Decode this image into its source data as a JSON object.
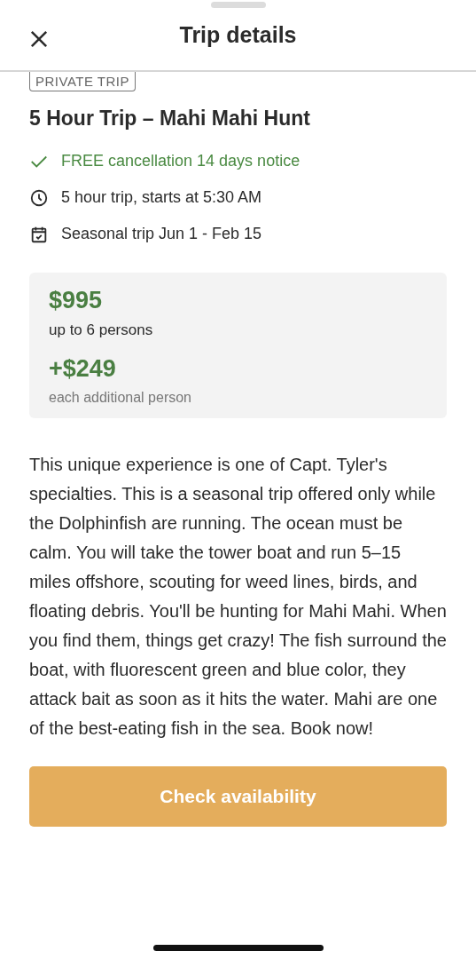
{
  "header": {
    "title": "Trip details"
  },
  "tag": "PRIVATE TRIP",
  "trip_title": "5 Hour Trip – Mahi Mahi Hunt",
  "features": [
    {
      "kind": "check",
      "text": "FREE cancellation 14 days notice"
    },
    {
      "kind": "clock",
      "text": "5 hour trip, starts at 5:30 AM"
    },
    {
      "kind": "calendar",
      "text": "Seasonal trip Jun 1 - Feb 15"
    }
  ],
  "pricing": {
    "price": "$995",
    "price_note": "up to 6 persons",
    "extra_price": "+$249",
    "extra_note": "each additional person"
  },
  "description": "This unique experience is one of Capt. Tyler's specialties. This is a seasonal trip offered only while the Dolphinfish are running. The ocean must be calm. You will take the tower boat and run 5–15 miles offshore, scouting for weed lines, birds, and floating debris. You'll be hunting for Mahi Mahi. When you find them, things get crazy! The fish surround the boat, with fluorescent green and blue color, they attack bait as soon as it hits the water. Mahi are one of the best-eating fish in the sea. Book now!",
  "button": "Check availability"
}
